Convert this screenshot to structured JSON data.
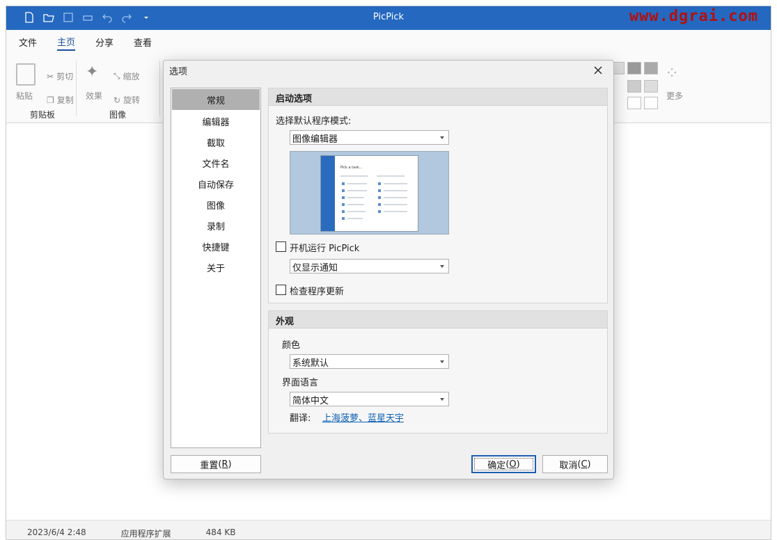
{
  "app": {
    "title": "PicPick",
    "watermark": "www.dgrai.com",
    "menu": [
      "文件",
      "主页",
      "分享",
      "查看"
    ],
    "active_menu": "主页",
    "ribbon": {
      "paste": "粘贴",
      "cut": "剪切",
      "copy": "复制",
      "clipboard_group": "剪贴板",
      "effects": "效果",
      "resize": "缩放",
      "rotate": "旋转",
      "image_group": "图像",
      "more": "更多"
    },
    "status": {
      "date": "2023/6/4 2:48",
      "type": "应用程序扩展",
      "size": "484 KB"
    }
  },
  "dialog": {
    "title": "选项",
    "nav": [
      "常规",
      "编辑器",
      "截取",
      "文件名",
      "自动保存",
      "图像",
      "录制",
      "快捷键",
      "关于"
    ],
    "selected_nav": "常规",
    "startup": {
      "header": "启动选项",
      "mode_label": "选择默认程序模式:",
      "mode_value": "图像编辑器",
      "run_at_startup_label": "开机运行 PicPick",
      "run_at_startup_checked": false,
      "notify_value": "仅显示通知",
      "check_update_label": "检查程序更新",
      "check_update_checked": false,
      "preview": {
        "heading": "Pick a task..."
      }
    },
    "appearance": {
      "header": "外观",
      "color_label": "颜色",
      "color_value": "系统默认",
      "language_label": "界面语言",
      "language_value": "简体中文",
      "translate_label": "翻译:",
      "translator": "上海菠萝、蓝星天宇"
    },
    "buttons": {
      "reset": "重置",
      "reset_key": "R",
      "ok": "确定",
      "ok_key": "O",
      "cancel": "取消",
      "cancel_key": "C"
    }
  },
  "colors": {
    "titlebar": "#2468c0",
    "watermark": "#b31010",
    "link": "#0d5fb3",
    "nav_selected": "#b0b0b0"
  }
}
